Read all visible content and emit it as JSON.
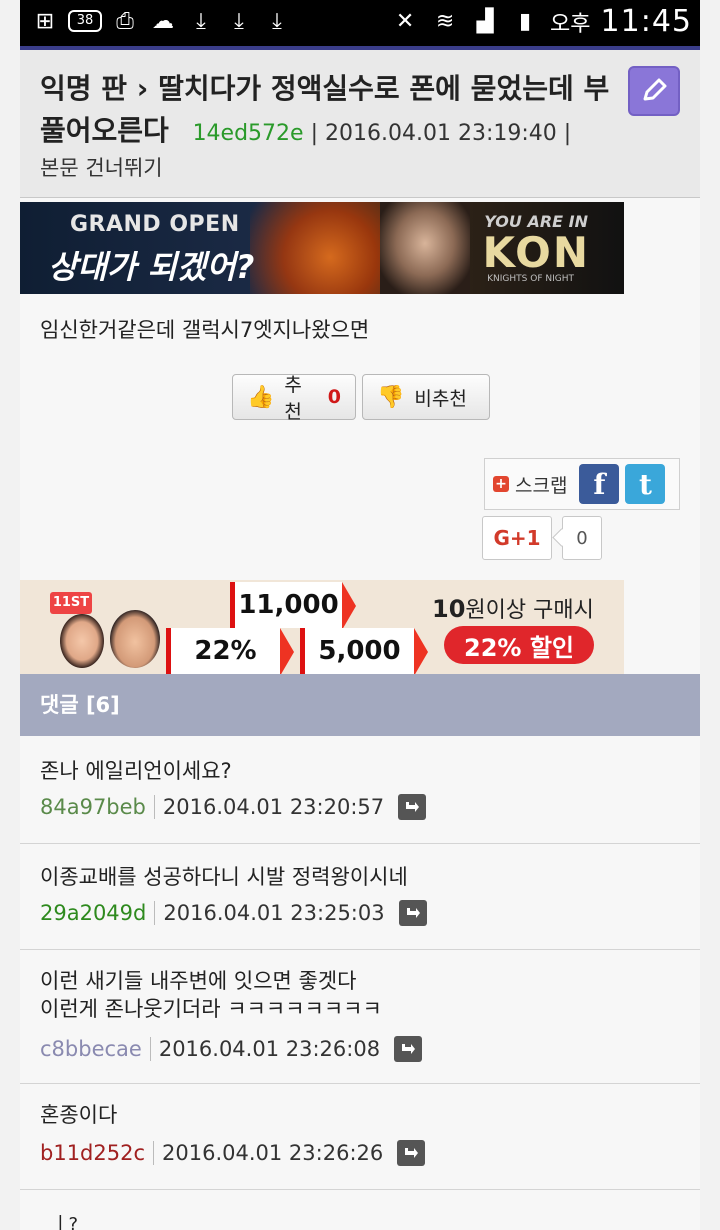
{
  "status_bar": {
    "badge_count": "38",
    "ampm": "오후",
    "time": "11:45"
  },
  "post": {
    "board": "익명 판",
    "separator": "›",
    "title": "딸치다가 정액실수로 폰에 묻었는데 부풀어오른다",
    "author_id": "14ed572e",
    "datetime": "2016.04.01 23:19:40",
    "skip_label": "본문 건너뛰기",
    "body": "임신한거같은데 갤럭시7엣지나왔으면"
  },
  "ad_top": {
    "line1": "GRAND OPEN",
    "line2": "상대가 되겠어?",
    "tagline": "YOU ARE IN",
    "logo": "KON",
    "logo_sub": "KNIGHTS OF NIGHT"
  },
  "votes": {
    "up_label": "추천",
    "up_count": "0",
    "down_label": "비추천"
  },
  "share": {
    "scrap_label": "스크랩",
    "facebook": "f",
    "twitter": "t",
    "gplus_label": "G+1",
    "gplus_count": "0"
  },
  "ad_shop": {
    "logo": "11ST",
    "price1": "11,000",
    "price2": "22%",
    "price3": "5,000",
    "line_num": "10",
    "line_rest": "원이상 구매시",
    "pill": "22% 할인"
  },
  "comments_header": "댓글 [6]",
  "comments": [
    {
      "text": "존나 에일리언이세요?",
      "id": "84a97beb",
      "id_color": "#5a8a4a",
      "datetime": "2016.04.01 23:20:57"
    },
    {
      "text": "이종교배를 성공하다니 시발 정력왕이시네",
      "id": "29a2049d",
      "id_color": "#2e8a1e",
      "datetime": "2016.04.01 23:25:03"
    },
    {
      "text": "이런 새기들 내주변에 잇으면 좋겟다",
      "text2": "이런게 존나웃기더라 ㅋㅋㅋㅋㅋㅋㅋㅋ",
      "id": "c8bbecae",
      "id_color": "#8a8ab0",
      "datetime": "2016.04.01 23:26:08"
    },
    {
      "text": "혼종이다",
      "id": "b11d252c",
      "id_color": "#a02020",
      "datetime": "2016.04.01 23:26:26"
    }
  ],
  "partial_next": "ㅣ?"
}
